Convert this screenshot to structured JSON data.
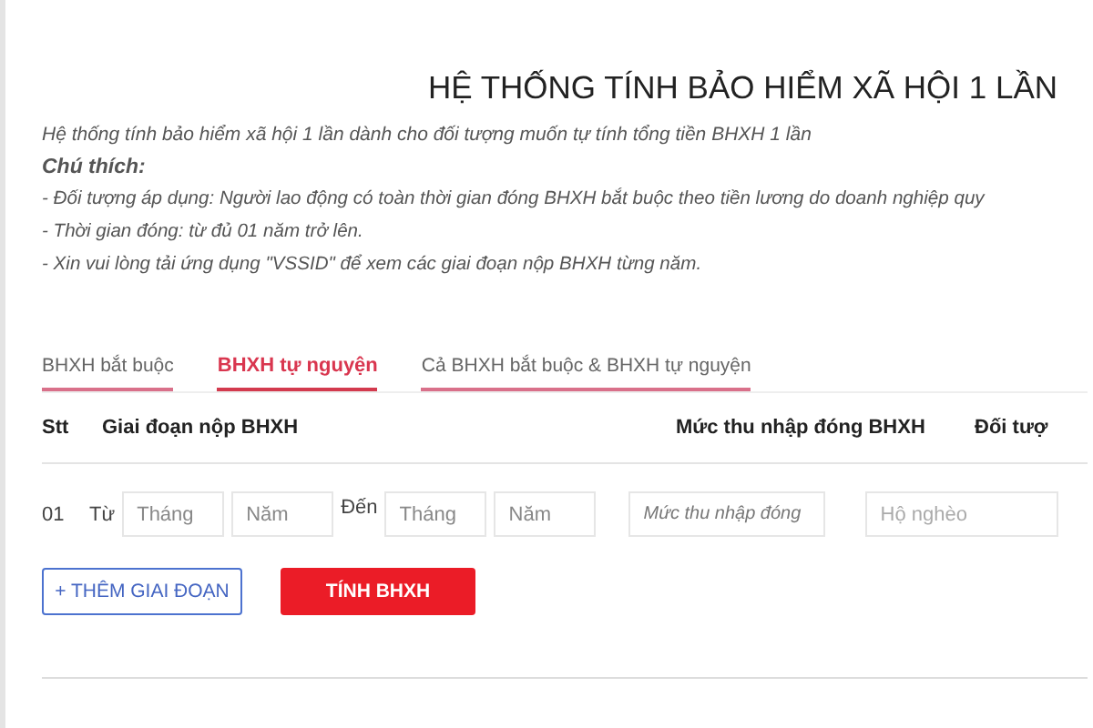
{
  "title": "HỆ THỐNG TÍNH BẢO HIỂM XÃ HỘI 1 LẦN",
  "intro": "Hệ thống tính bảo hiểm xã hội 1 lần dành cho đối tượng muốn tự tính tổng tiền BHXH 1 lần",
  "notes_heading": "Chú thích:",
  "notes": [
    "- Đối tượng áp dụng: Người lao động có toàn thời gian đóng BHXH bắt buộc theo tiền lương do doanh nghiệp quy",
    "- Thời gian đóng: từ đủ 01 năm trở lên.",
    "- Xin vui lòng tải ứng dụng \"VSSID\" để xem các giai đoạn nộp BHXH từng năm."
  ],
  "tabs": [
    {
      "label": "BHXH bắt buộc",
      "selected": false
    },
    {
      "label": "BHXH tự nguyện",
      "selected": true
    },
    {
      "label": "Cả BHXH bắt buộc & BHXH tự nguyện",
      "selected": false
    }
  ],
  "columns": [
    "Stt",
    "Giai đoạn nộp BHXH",
    "Mức thu nhập đóng BHXH",
    "Đối tượ"
  ],
  "row": {
    "index": "01",
    "from_label": "Từ",
    "from_month": {
      "placeholder": "Tháng"
    },
    "from_year": {
      "placeholder": "Năm"
    },
    "to_label": "Đến",
    "to_month": {
      "placeholder": "Tháng"
    },
    "to_year": {
      "placeholder": "Năm"
    },
    "income": {
      "placeholder": "Mức thu nhập đóng"
    },
    "subject": {
      "placeholder": "Hộ nghèo"
    }
  },
  "add_button": "+ THÊM GIAI ĐOẠN",
  "calc_button": "TÍNH BHXH"
}
